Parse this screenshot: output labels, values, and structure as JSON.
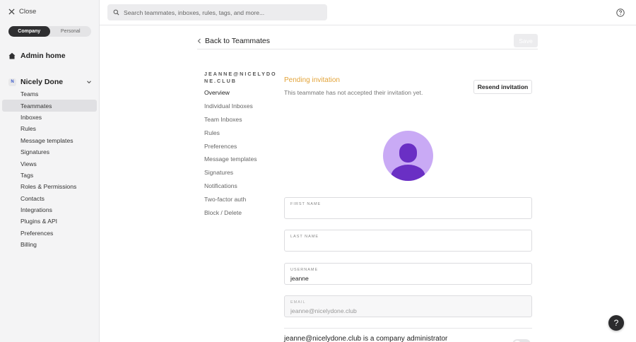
{
  "sidebar": {
    "close_label": "Close",
    "scope": {
      "company": "Company",
      "personal": "Personal",
      "selected": "Company"
    },
    "admin_home": "Admin home",
    "company": {
      "badge": "N",
      "name": "Nicely Done"
    },
    "items": [
      {
        "label": "Teams"
      },
      {
        "label": "Teammates"
      },
      {
        "label": "Inboxes"
      },
      {
        "label": "Rules"
      },
      {
        "label": "Message templates"
      },
      {
        "label": "Signatures"
      },
      {
        "label": "Views"
      },
      {
        "label": "Tags"
      },
      {
        "label": "Roles & Permissions"
      },
      {
        "label": "Contacts"
      },
      {
        "label": "Integrations"
      },
      {
        "label": "Plugins & API"
      },
      {
        "label": "Preferences"
      },
      {
        "label": "Billing"
      }
    ],
    "active_item": "Teammates"
  },
  "search": {
    "placeholder": "Search teammates, inboxes, rules, tags, and more..."
  },
  "header": {
    "back_label": "Back to Teammates",
    "save_label": "Save"
  },
  "teammate": {
    "email_heading": "JEANNE@NICELYDONE.CLUB",
    "nav": [
      {
        "label": "Overview"
      },
      {
        "label": "Individual Inboxes"
      },
      {
        "label": "Team Inboxes"
      },
      {
        "label": "Rules"
      },
      {
        "label": "Preferences"
      },
      {
        "label": "Message templates"
      },
      {
        "label": "Signatures"
      },
      {
        "label": "Notifications"
      },
      {
        "label": "Two-factor auth"
      },
      {
        "label": "Block / Delete"
      }
    ],
    "active_nav": "Overview"
  },
  "invitation": {
    "title": "Pending invitation",
    "description": "This teammate has not accepted their invitation yet.",
    "resend_label": "Resend invitation"
  },
  "form": {
    "first_name": {
      "label": "FIRST NAME",
      "value": ""
    },
    "last_name": {
      "label": "LAST NAME",
      "value": ""
    },
    "username": {
      "label": "USERNAME",
      "value": "jeanne"
    },
    "email": {
      "label": "EMAIL",
      "value": "jeanne@nicelydone.club"
    }
  },
  "admin_note": "jeanne@nicelydone.club is a company administrator",
  "help_label": "?",
  "colors": {
    "pending": "#e3a43a",
    "avatar_bg": "#c9aaf5",
    "avatar_fg": "#6a2fc4"
  }
}
